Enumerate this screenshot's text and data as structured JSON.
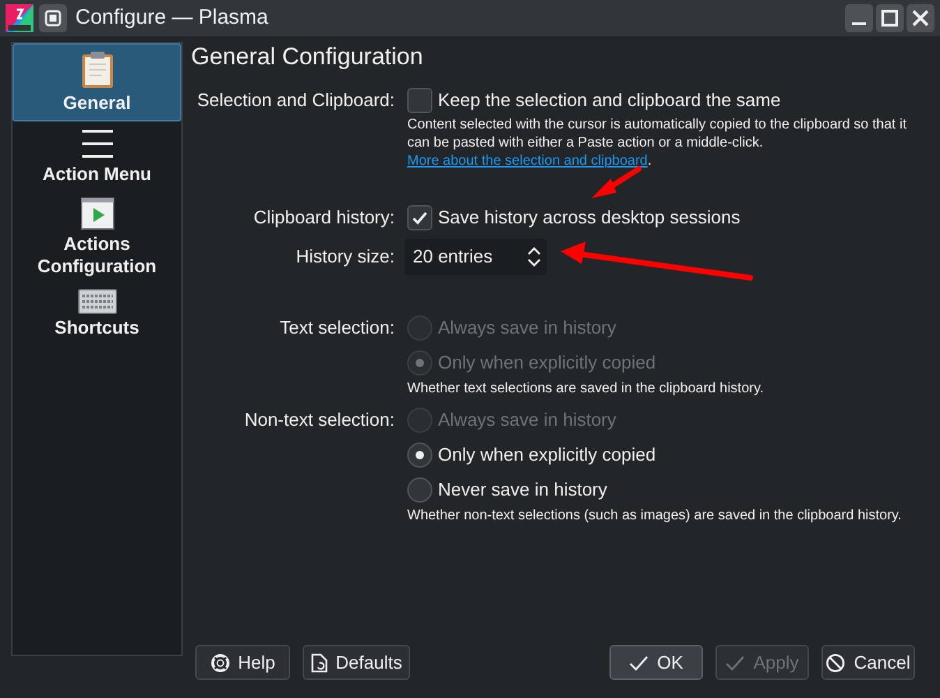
{
  "window": {
    "title": "Configure — Plasma"
  },
  "sidebar": {
    "items": [
      {
        "label": "General",
        "selected": true
      },
      {
        "label": "Action Menu",
        "selected": false
      },
      {
        "label": "Actions Configuration",
        "selected": false
      },
      {
        "label": "Shortcuts",
        "selected": false
      }
    ]
  },
  "page": {
    "title": "General Configuration"
  },
  "form": [
    {
      "kind": "checkbox",
      "label": "Selection and Clipboard:",
      "text": "Keep the selection and clipboard the same",
      "checked": false,
      "note": "Content selected with the cursor is automatically copied to the clipboard so that it can be pasted with either a Paste action or a middle-click.",
      "link": "More about the selection and clipboard",
      "link_suffix": "."
    },
    {
      "kind": "checkbox",
      "label": "Clipboard history:",
      "text": "Save history across desktop sessions",
      "checked": true
    },
    {
      "kind": "spinbox",
      "label": "History size:",
      "value": "20 entries"
    },
    {
      "kind": "radio",
      "label": "Text selection:",
      "options": [
        {
          "text": "Always save in history",
          "selected": false,
          "disabled": true
        },
        {
          "text": "Only when explicitly copied",
          "selected": true,
          "disabled": true
        }
      ],
      "note": "Whether text selections are saved in the clipboard history."
    },
    {
      "kind": "radio",
      "label": "Non-text selection:",
      "options": [
        {
          "text": "Always save in history",
          "selected": false,
          "disabled": true
        },
        {
          "text": "Only when explicitly copied",
          "selected": true,
          "disabled": false
        },
        {
          "text": "Never save in history",
          "selected": false,
          "disabled": false
        }
      ],
      "note": "Whether non-text selections (such as images) are saved in the clipboard history."
    }
  ],
  "buttons": [
    {
      "label": "Help",
      "disabled": false,
      "default": false
    },
    {
      "label": "Defaults",
      "disabled": false,
      "default": false
    },
    {
      "label": "OK",
      "disabled": false,
      "default": true
    },
    {
      "label": "Apply",
      "disabled": true,
      "default": false
    },
    {
      "label": "Cancel",
      "disabled": false,
      "default": false
    }
  ],
  "annotations": [
    {
      "kind": "arrow",
      "color": "#ff0000"
    },
    {
      "kind": "arrow",
      "color": "#ff0000"
    }
  ]
}
